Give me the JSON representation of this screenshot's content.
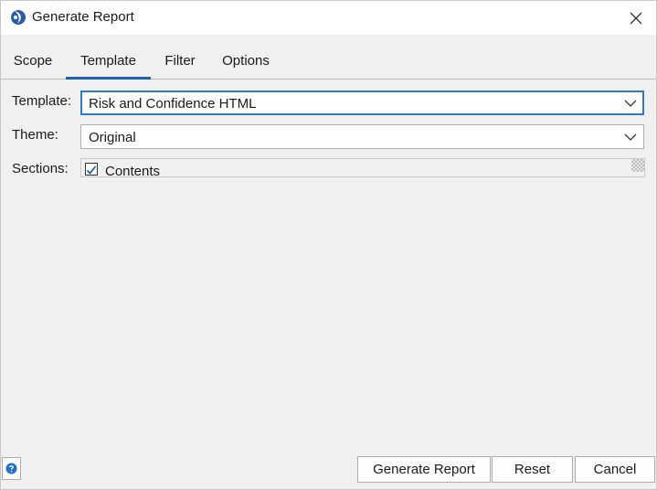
{
  "window": {
    "title": "Generate Report",
    "icons": {
      "app": "app-logo-icon",
      "close": "close-icon"
    }
  },
  "tabs": [
    {
      "label": "Scope",
      "active": false
    },
    {
      "label": "Template",
      "active": true
    },
    {
      "label": "Filter",
      "active": false
    },
    {
      "label": "Options",
      "active": false
    }
  ],
  "form": {
    "template": {
      "label": "Template:",
      "value": "Risk and Confidence HTML"
    },
    "theme": {
      "label": "Theme:",
      "value": "Original"
    },
    "sections": {
      "label": "Sections:",
      "items": [
        {
          "label": "Contents",
          "checked": true
        }
      ]
    }
  },
  "footer": {
    "help_icon": "help-icon",
    "generate_label": "Generate Report",
    "reset_label": "Reset",
    "cancel_label": "Cancel"
  },
  "colors": {
    "accent": "#1f5fae",
    "focus_border": "#2f79c9",
    "dialog_bg": "#f0f0f0"
  }
}
